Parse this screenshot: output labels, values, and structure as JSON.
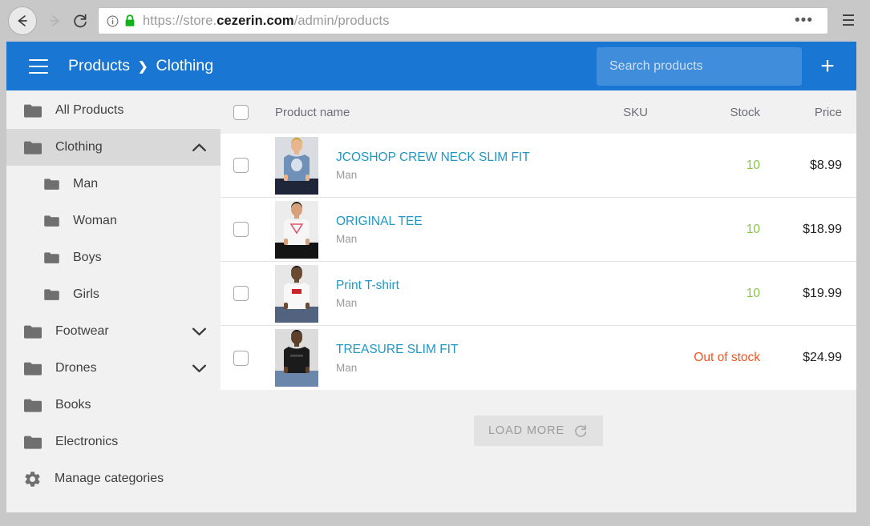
{
  "browser": {
    "url_prefix": "https://store.",
    "url_host": "cezerin.com",
    "url_path": "/admin/products",
    "back_icon": "back-arrow-icon",
    "forward_icon": "forward-arrow-icon",
    "reload_icon": "reload-icon",
    "info_icon": "page-info-icon",
    "lock_icon": "lock-icon",
    "more_label": "•••",
    "menu_label": "☰"
  },
  "appbar": {
    "menu_icon": "hamburger-menu-icon",
    "breadcrumb": {
      "root": "Products",
      "separator": "❯",
      "current": "Clothing"
    },
    "search_placeholder": "Search products",
    "search_value": "",
    "add_label": "+",
    "background": "#1976d2",
    "search_background": "#3f8ddb"
  },
  "sidebar": {
    "items": [
      {
        "label": "All Products",
        "icon": "folder-icon",
        "level": 0,
        "selected": false,
        "chevron": ""
      },
      {
        "label": "Clothing",
        "icon": "folder-icon",
        "level": 0,
        "selected": true,
        "chevron": "up"
      },
      {
        "label": "Man",
        "icon": "folder-icon",
        "level": 1,
        "selected": false,
        "chevron": ""
      },
      {
        "label": "Woman",
        "icon": "folder-icon",
        "level": 1,
        "selected": false,
        "chevron": ""
      },
      {
        "label": "Boys",
        "icon": "folder-icon",
        "level": 1,
        "selected": false,
        "chevron": ""
      },
      {
        "label": "Girls",
        "icon": "folder-icon",
        "level": 1,
        "selected": false,
        "chevron": ""
      },
      {
        "label": "Footwear",
        "icon": "folder-icon",
        "level": 0,
        "selected": false,
        "chevron": "down"
      },
      {
        "label": "Drones",
        "icon": "folder-icon",
        "level": 0,
        "selected": false,
        "chevron": "down"
      },
      {
        "label": "Books",
        "icon": "folder-icon",
        "level": 0,
        "selected": false,
        "chevron": ""
      },
      {
        "label": "Electronics",
        "icon": "folder-icon",
        "level": 0,
        "selected": false,
        "chevron": ""
      },
      {
        "label": "Manage categories",
        "icon": "gear-icon",
        "level": 0,
        "selected": false,
        "chevron": ""
      }
    ]
  },
  "table": {
    "columns": {
      "select_all": "select-all-checkbox",
      "name": "Product name",
      "sku": "SKU",
      "stock": "Stock",
      "price": "Price"
    },
    "rows": [
      {
        "name": "JCOSHOP CREW NECK SLIM FIT",
        "category": "Man",
        "sku": "",
        "stock": "10",
        "stock_state": "in",
        "price": "$8.99",
        "thumb": "man-in-blue-tshirt-photo"
      },
      {
        "name": "ORIGINAL TEE",
        "category": "Man",
        "sku": "",
        "stock": "10",
        "stock_state": "in",
        "price": "$18.99",
        "thumb": "man-in-white-tshirt-photo"
      },
      {
        "name": "Print T-shirt",
        "category": "Man",
        "sku": "",
        "stock": "10",
        "stock_state": "in",
        "price": "$19.99",
        "thumb": "man-in-white-print-tshirt-photo"
      },
      {
        "name": "TREASURE SLIM FIT",
        "category": "Man",
        "sku": "",
        "stock": "Out of stock",
        "stock_state": "out",
        "price": "$24.99",
        "thumb": "man-in-black-tshirt-photo"
      }
    ]
  },
  "footer": {
    "load_more_label": "LOAD MORE",
    "load_more_icon": "refresh-icon"
  },
  "colors": {
    "accent": "#1976d2",
    "link": "#2196c4",
    "in_stock": "#8bc34a",
    "out_of_stock": "#f4511e"
  }
}
